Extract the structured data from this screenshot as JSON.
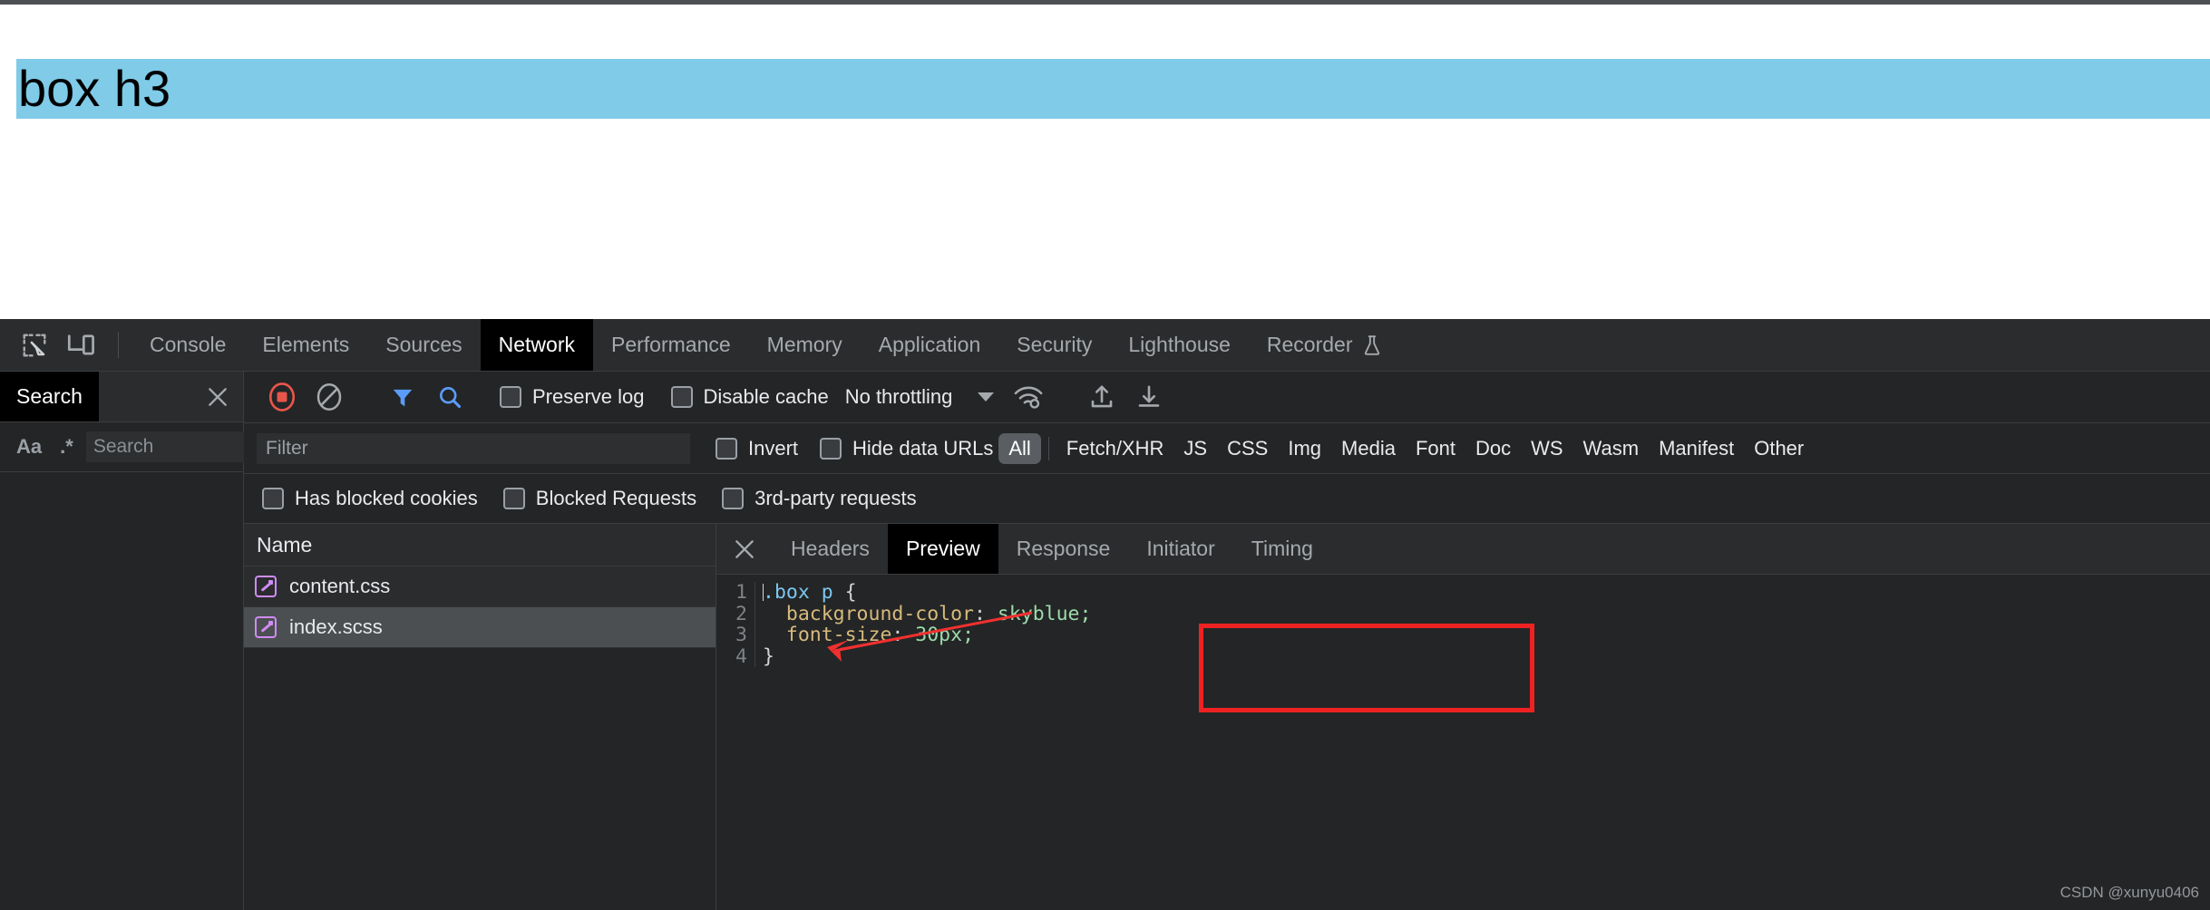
{
  "page": {
    "heading": "box h3"
  },
  "devtools": {
    "toolbar_icons": [
      {
        "name": "inspect-element-icon"
      },
      {
        "name": "device-toolbar-icon"
      }
    ],
    "tabs": [
      {
        "label": "Console",
        "active": false
      },
      {
        "label": "Elements",
        "active": false
      },
      {
        "label": "Sources",
        "active": false
      },
      {
        "label": "Network",
        "active": true
      },
      {
        "label": "Performance",
        "active": false
      },
      {
        "label": "Memory",
        "active": false
      },
      {
        "label": "Application",
        "active": false
      },
      {
        "label": "Security",
        "active": false
      },
      {
        "label": "Lighthouse",
        "active": false
      },
      {
        "label": "Recorder",
        "active": false,
        "icon": "flask-experiment-icon"
      }
    ]
  },
  "search_panel": {
    "tab_label": "Search",
    "close_icon": "close-icon",
    "match_case_label": "Aa",
    "regex_label": ".*",
    "query_value": "",
    "query_placeholder": "Search",
    "refresh_icon": "refresh-icon",
    "clear_icon": "clear-icon",
    "results": []
  },
  "network": {
    "toolbar": {
      "record_icon": "record-stop-icon",
      "clear_icon": "clear-icon",
      "filter_icon": "filter-funnel-icon",
      "search_icon": "search-icon",
      "preserve_log": {
        "label": "Preserve log",
        "checked": false
      },
      "disable_cache": {
        "label": "Disable cache",
        "checked": false
      },
      "throttling": {
        "value": "No throttling",
        "caret": "chevron-down-icon"
      },
      "network_conditions_icon": "wifi-settings-icon",
      "import_icon": "import-har-icon",
      "export_icon": "export-har-icon"
    },
    "filterbar": {
      "filter_value": "",
      "filter_placeholder": "Filter",
      "invert": {
        "label": "Invert",
        "checked": false
      },
      "hide_data_urls": {
        "label": "Hide data URLs",
        "checked": false
      },
      "types": [
        {
          "label": "All",
          "active": true
        },
        {
          "label": "Fetch/XHR",
          "active": false
        },
        {
          "label": "JS",
          "active": false
        },
        {
          "label": "CSS",
          "active": false
        },
        {
          "label": "Img",
          "active": false
        },
        {
          "label": "Media",
          "active": false
        },
        {
          "label": "Font",
          "active": false
        },
        {
          "label": "Doc",
          "active": false
        },
        {
          "label": "WS",
          "active": false
        },
        {
          "label": "Wasm",
          "active": false
        },
        {
          "label": "Manifest",
          "active": false
        },
        {
          "label": "Other",
          "active": false
        }
      ]
    },
    "checkrow": [
      {
        "label": "Has blocked cookies",
        "checked": false
      },
      {
        "label": "Blocked Requests",
        "checked": false
      },
      {
        "label": "3rd-party requests",
        "checked": false
      }
    ],
    "requests": {
      "column_header": "Name",
      "rows": [
        {
          "name": "content.css",
          "icon": "stylesheet-icon",
          "selected": false
        },
        {
          "name": "index.scss",
          "icon": "stylesheet-icon",
          "selected": true
        }
      ]
    },
    "details": {
      "close_icon": "close-icon",
      "tabs": [
        {
          "label": "Headers",
          "active": false
        },
        {
          "label": "Preview",
          "active": true
        },
        {
          "label": "Response",
          "active": false
        },
        {
          "label": "Initiator",
          "active": false
        },
        {
          "label": "Timing",
          "active": false
        }
      ],
      "preview": {
        "line_numbers": [
          "1",
          "2",
          "3",
          "4"
        ],
        "code_lines": [
          {
            "tokens": [
              {
                "t": ".box",
                "c": "tok-sel"
              },
              {
                "t": " ",
                "c": "tok-pun"
              },
              {
                "t": "p",
                "c": "tok-sel"
              },
              {
                "t": " {",
                "c": "tok-pun"
              }
            ]
          },
          {
            "tokens": [
              {
                "t": "  ",
                "c": "tok-pun"
              },
              {
                "t": "background-color",
                "c": "tok-prop"
              },
              {
                "t": ": ",
                "c": "tok-pun"
              },
              {
                "t": "skyblue",
                "c": "tok-val"
              },
              {
                "t": ";",
                "c": "tok-val"
              }
            ]
          },
          {
            "tokens": [
              {
                "t": "  ",
                "c": "tok-pun"
              },
              {
                "t": "font-size",
                "c": "tok-prop"
              },
              {
                "t": ": ",
                "c": "tok-pun"
              },
              {
                "t": "30px",
                "c": "tok-val"
              },
              {
                "t": ";",
                "c": "tok-val"
              }
            ]
          },
          {
            "tokens": [
              {
                "t": "}",
                "c": "tok-pun"
              }
            ]
          }
        ],
        "plain_text": ".box p {\n  background-color: skyblue;\n  font-size: 30px;\n}"
      }
    }
  },
  "annotations": {
    "highlight_box_color": "#ee2222",
    "arrow_color": "#f23030"
  },
  "watermark": "CSDN @xunyu0406",
  "colors": {
    "page_heading_background": "#7fcbe8",
    "devtools_background": "#242526",
    "active_tab_background": "#000000",
    "stylesheet_icon": "#d08cf5",
    "record_button": "#e8564b",
    "active_toolbar_icon": "#5a9cf8"
  }
}
